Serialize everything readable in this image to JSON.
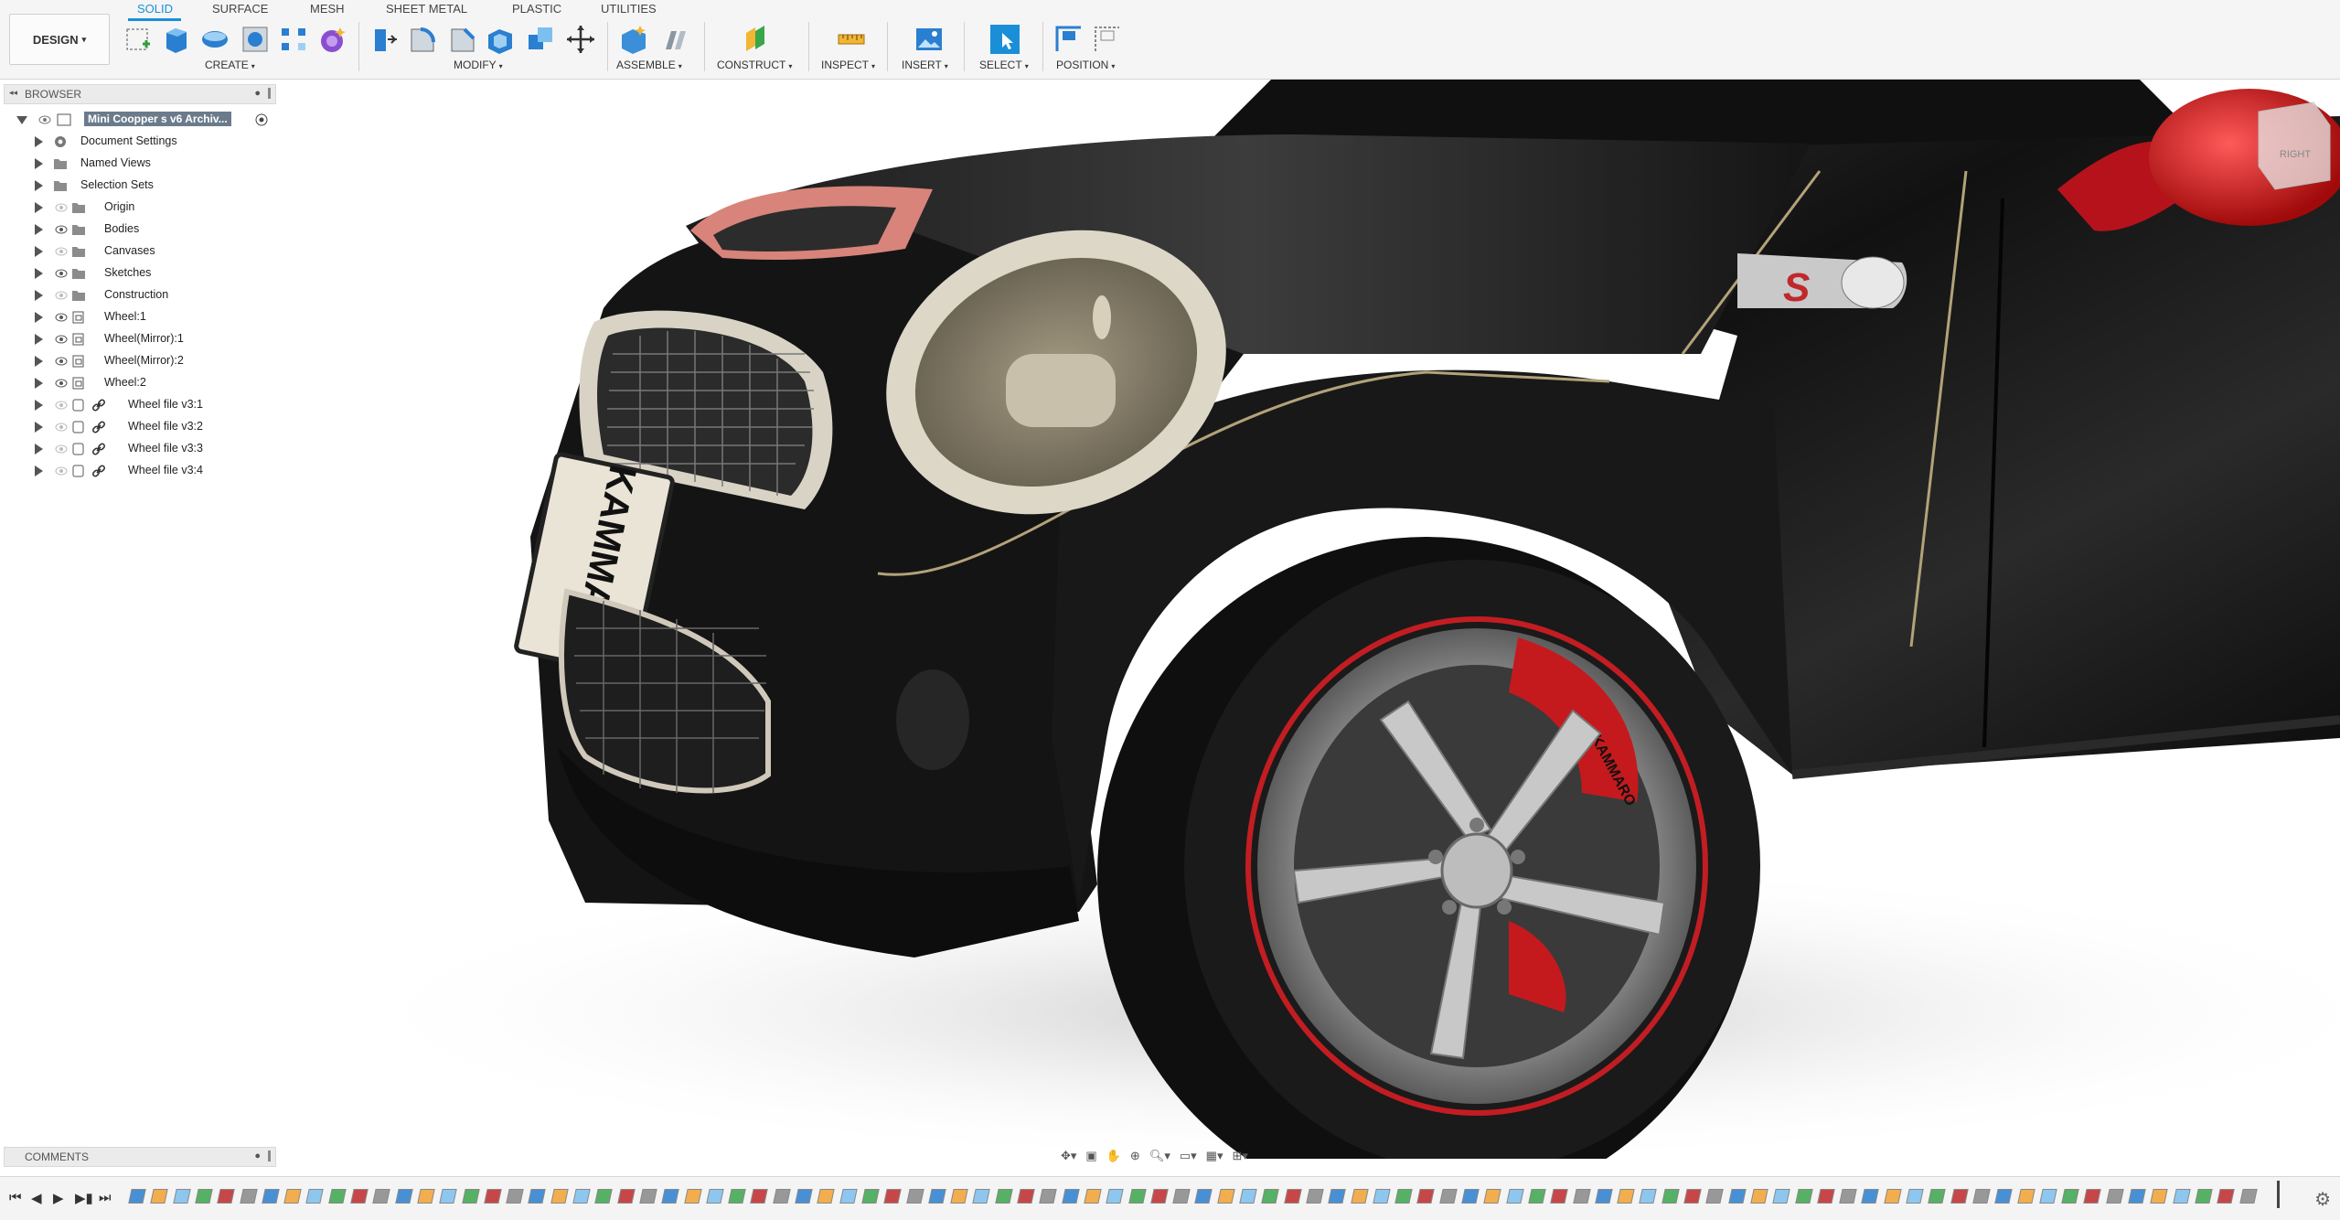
{
  "toolbar": {
    "workspace": "DESIGN",
    "tabs": [
      {
        "label": "SOLID",
        "active": true
      },
      {
        "label": "SURFACE",
        "active": false
      },
      {
        "label": "MESH",
        "active": false
      },
      {
        "label": "SHEET METAL",
        "active": false
      },
      {
        "label": "PLASTIC",
        "active": false
      },
      {
        "label": "UTILITIES",
        "active": false
      }
    ],
    "groups": [
      "CREATE",
      "MODIFY",
      "ASSEMBLE",
      "CONSTRUCT",
      "INSPECT",
      "INSERT",
      "SELECT",
      "POSITION"
    ],
    "accent_color": "#1a8fd8"
  },
  "browser": {
    "title": "BROWSER",
    "root": "Mini Coopper s v6 Archiv...",
    "items": [
      {
        "label": "Document Settings",
        "icon": "gear-icon"
      },
      {
        "label": "Named Views",
        "icon": "folder-icon"
      },
      {
        "label": "Selection Sets",
        "icon": "folder-icon"
      },
      {
        "label": "Origin",
        "icon": "folder-icon"
      },
      {
        "label": "Bodies",
        "icon": "folder-icon"
      },
      {
        "label": "Canvases",
        "icon": "folder-icon"
      },
      {
        "label": "Sketches",
        "icon": "folder-icon"
      },
      {
        "label": "Construction",
        "icon": "folder-icon"
      },
      {
        "label": "Wheel:1",
        "icon": "component-icon"
      },
      {
        "label": "Wheel(Mirror):1",
        "icon": "component-icon"
      },
      {
        "label": "Wheel(Mirror):2",
        "icon": "component-icon"
      },
      {
        "label": "Wheel:2",
        "icon": "component-icon"
      },
      {
        "label": "Wheel file v3:1",
        "icon": "link-icon"
      },
      {
        "label": "Wheel file v3:2",
        "icon": "link-icon"
      },
      {
        "label": "Wheel file v3:3",
        "icon": "link-icon"
      },
      {
        "label": "Wheel file v3:4",
        "icon": "link-icon"
      }
    ]
  },
  "comments": {
    "title": "COMMENTS"
  },
  "viewcube": {
    "face": "RIGHT"
  },
  "model": {
    "plate_text": "KAMMARO",
    "badge_text": "S",
    "caliper_text": "KAMMARO"
  }
}
